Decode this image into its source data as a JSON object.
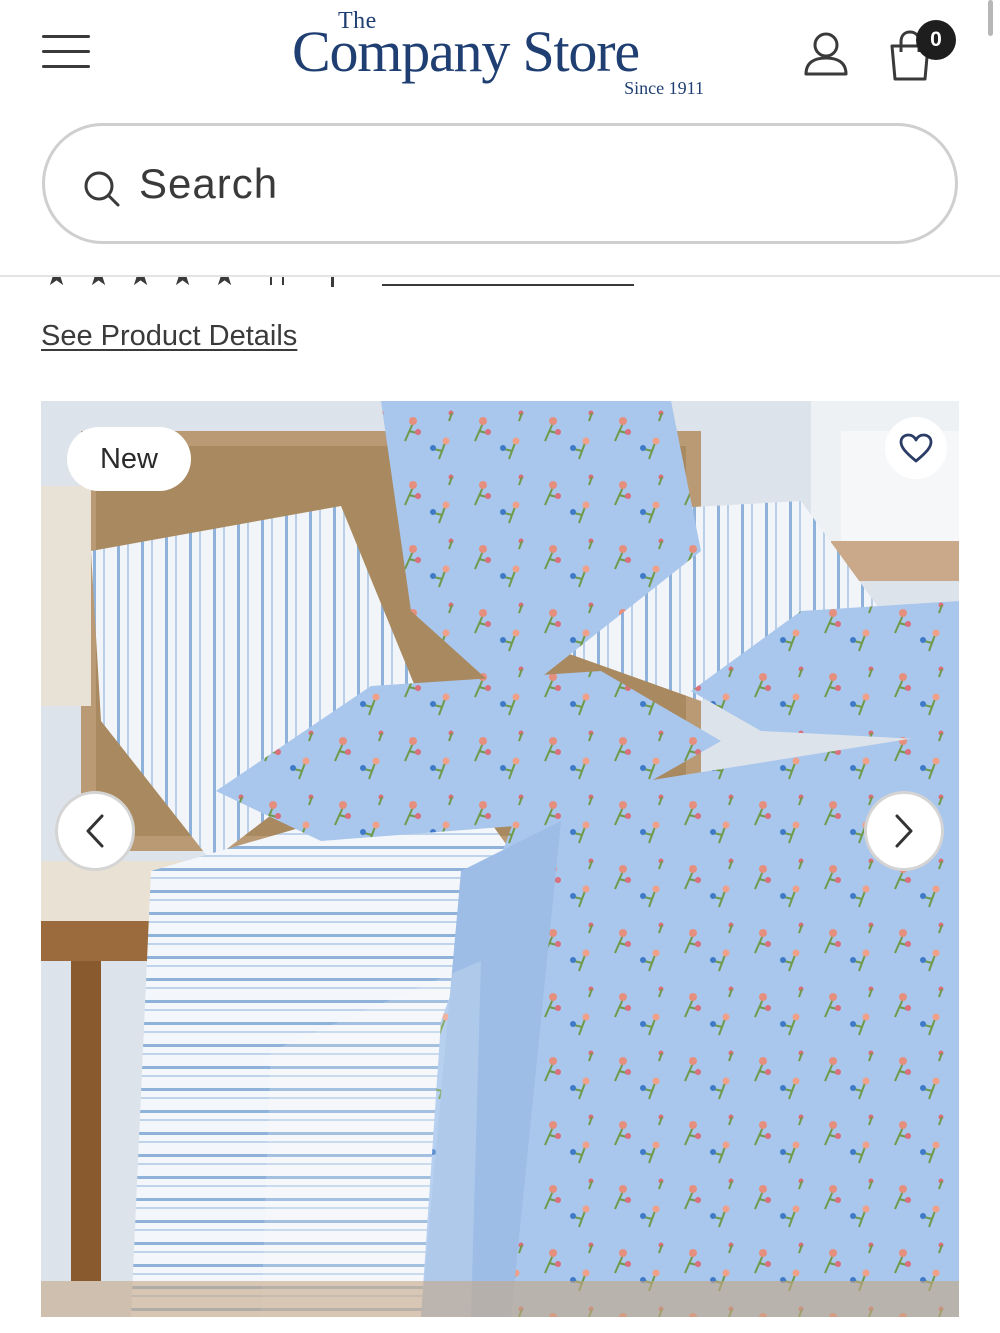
{
  "header": {
    "logo_the": "The",
    "logo_main": "Company Store",
    "logo_since": "Since 1911",
    "cart_count": "0",
    "icons": [
      "menu-icon",
      "account-icon",
      "shopping-bag-icon"
    ]
  },
  "search": {
    "placeholder": "Search",
    "icon": "search-icon"
  },
  "product": {
    "see_details_label": "See Product Details",
    "badge": "New",
    "gallery_icons": [
      "heart-icon",
      "chevron-left-icon",
      "chevron-right-icon"
    ]
  },
  "colors": {
    "brand_navy": "#1f3f73",
    "text": "#3a3a3a",
    "search_border": "#cfcfcf",
    "bedding_blue": "#a9c6ec"
  }
}
